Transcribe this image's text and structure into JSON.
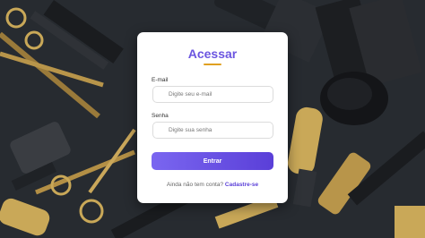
{
  "login": {
    "title": "Acessar",
    "email_label": "E-mail",
    "email_placeholder": "Digite seu e-mail",
    "email_value": "",
    "password_label": "Senha",
    "password_placeholder": "Digite sua senha",
    "password_value": "",
    "submit_label": "Entrar",
    "signup_prompt": "Ainda não tem conta?",
    "signup_link": "Cadastre-se"
  },
  "colors": {
    "accent": "#6b55e0",
    "title_underline": "#e0a020",
    "button_start": "#7a66f0",
    "button_end": "#5a3fd8",
    "background": "#2a2e33"
  },
  "background": {
    "icons": [
      "scissors-icon",
      "comb-icon",
      "brush-icon",
      "hair-clip-icon",
      "razor-icon"
    ]
  }
}
